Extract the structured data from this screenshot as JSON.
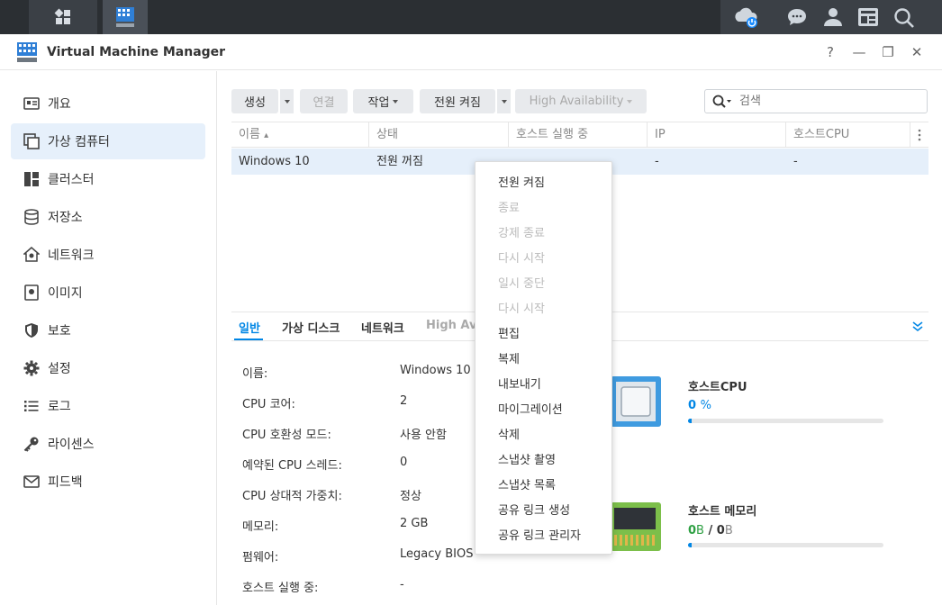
{
  "window": {
    "title": "Virtual Machine Manager",
    "help": "?",
    "minimize": "—",
    "restore": "❐",
    "close": "✕"
  },
  "sidebar": {
    "items": [
      {
        "label": "개요",
        "icon": "overview-icon"
      },
      {
        "label": "가상 컴퓨터",
        "icon": "virtual-machine-icon",
        "active": true
      },
      {
        "label": "클러스터",
        "icon": "cluster-icon"
      },
      {
        "label": "저장소",
        "icon": "storage-icon"
      },
      {
        "label": "네트워크",
        "icon": "network-icon"
      },
      {
        "label": "이미지",
        "icon": "image-icon"
      },
      {
        "label": "보호",
        "icon": "shield-icon"
      },
      {
        "label": "설정",
        "icon": "gear-icon"
      },
      {
        "label": "로그",
        "icon": "log-icon"
      },
      {
        "label": "라이센스",
        "icon": "key-icon"
      },
      {
        "label": "피드백",
        "icon": "mail-icon"
      }
    ]
  },
  "toolbar": {
    "create": "생성",
    "connect": "연결",
    "action": "작업",
    "power_on": "전원 켜짐",
    "high_availability": "High Availability",
    "search_placeholder": "검색"
  },
  "table": {
    "columns": [
      "이름",
      "상태",
      "호스트 실행 중",
      "IP",
      "호스트CPU"
    ],
    "sort_indicator": "▴",
    "rows": [
      {
        "name": "Windows 10",
        "status": "전원 꺼짐",
        "host": "",
        "ip": "-",
        "cpu": "-"
      }
    ]
  },
  "detail": {
    "tabs": [
      "일반",
      "가상 디스크",
      "네트워크",
      "High Ava"
    ],
    "properties": [
      {
        "label": "이름:",
        "value": "Windows 10"
      },
      {
        "label": "CPU 코어:",
        "value": "2"
      },
      {
        "label": "CPU 호환성 모드:",
        "value": "사용 안함"
      },
      {
        "label": "예약된 CPU 스레드:",
        "value": "0"
      },
      {
        "label": "CPU 상대적 가중치:",
        "value": "정상"
      },
      {
        "label": "메모리:",
        "value": "2 GB"
      },
      {
        "label": "펌웨어:",
        "value": "Legacy BIOS"
      },
      {
        "label": "호스트 실행 중:",
        "value": "-"
      }
    ],
    "host_cpu": {
      "title": "호스트CPU",
      "value": "0",
      "unit": "%",
      "percent": 2
    },
    "host_memory": {
      "title": "호스트 메모리",
      "used": "0",
      "used_unit": "B",
      "sep": " / ",
      "total": "0",
      "total_unit": "B",
      "percent": 2
    },
    "colors": {
      "accent": "#0086e5",
      "memory": "#2ea043"
    }
  },
  "context_menu": {
    "items": [
      {
        "label": "전원 켜짐",
        "enabled": true
      },
      {
        "label": "종료",
        "enabled": false
      },
      {
        "label": "강제 종료",
        "enabled": false
      },
      {
        "label": "다시 시작",
        "enabled": false
      },
      {
        "label": "일시 중단",
        "enabled": false
      },
      {
        "label": "다시 시작",
        "enabled": false
      },
      {
        "label": "편집",
        "enabled": true
      },
      {
        "label": "복제",
        "enabled": true
      },
      {
        "label": "내보내기",
        "enabled": true
      },
      {
        "label": "마이그레이션",
        "enabled": true
      },
      {
        "label": "삭제",
        "enabled": true
      },
      {
        "label": "스냅샷 촬영",
        "enabled": true
      },
      {
        "label": "스냅샷 목록",
        "enabled": true
      },
      {
        "label": "공유 링크 생성",
        "enabled": true
      },
      {
        "label": "공유 링크 관리자",
        "enabled": true
      }
    ]
  }
}
